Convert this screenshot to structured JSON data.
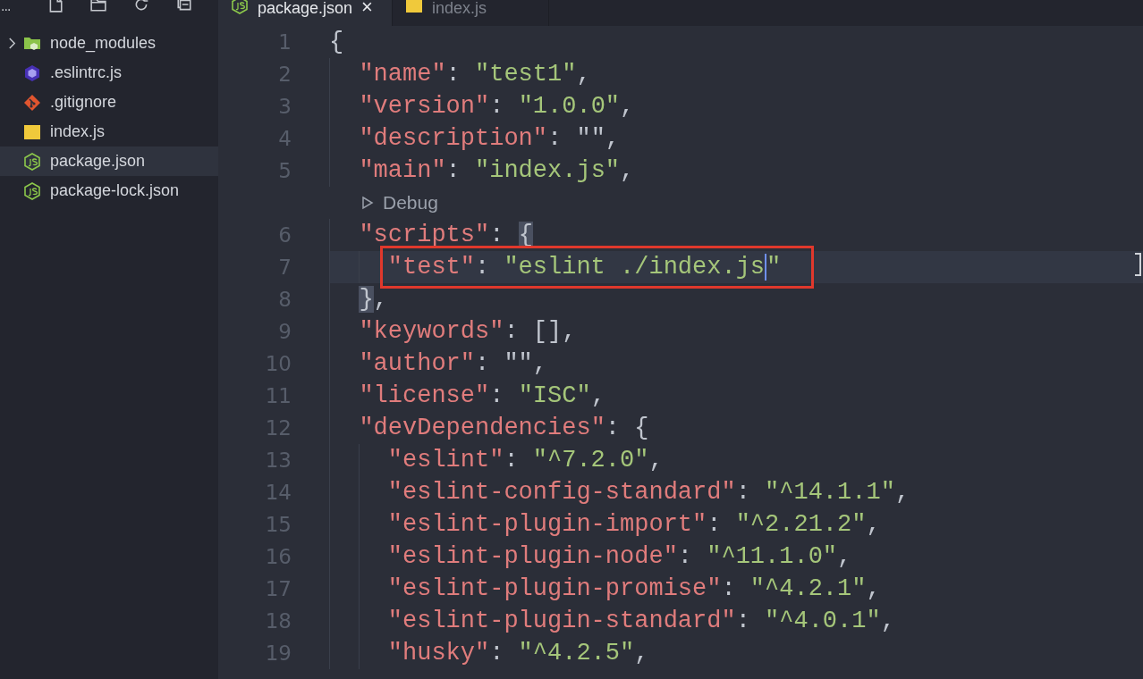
{
  "sidebar": {
    "toolbar": {
      "more": "..."
    },
    "files": [
      {
        "name": "node_modules",
        "kind": "folder",
        "expanded": false,
        "selected": false
      },
      {
        "name": ".eslintrc.js",
        "kind": "eslint",
        "selected": false
      },
      {
        "name": ".gitignore",
        "kind": "git",
        "selected": false
      },
      {
        "name": "index.js",
        "kind": "js",
        "selected": false
      },
      {
        "name": "package.json",
        "kind": "node",
        "selected": true
      },
      {
        "name": "package-lock.json",
        "kind": "node",
        "selected": false
      }
    ]
  },
  "tabs": [
    {
      "label": "package.json",
      "kind": "node",
      "selected": true,
      "close": "×"
    },
    {
      "label": "index.js",
      "kind": "js",
      "selected": false
    }
  ],
  "editor": {
    "lines": [
      {
        "kind": "code",
        "number": "1",
        "segments": [
          {
            "kind": "punct",
            "text": "{"
          }
        ],
        "children": [
          {
            "kind": "code",
            "number": "2",
            "segments": [
              {
                "kind": "key",
                "text": "\"name\""
              },
              {
                "kind": "punct",
                "text": ": "
              },
              {
                "kind": "string",
                "text": "\"test1\""
              },
              {
                "kind": "punct",
                "text": ","
              }
            ]
          },
          {
            "kind": "code",
            "number": "3",
            "segments": [
              {
                "kind": "key",
                "text": "\"version\""
              },
              {
                "kind": "punct",
                "text": ": "
              },
              {
                "kind": "string",
                "text": "\"1.0.0\""
              },
              {
                "kind": "punct",
                "text": ","
              }
            ]
          },
          {
            "kind": "code",
            "number": "4",
            "segments": [
              {
                "kind": "key",
                "text": "\"description\""
              },
              {
                "kind": "punct",
                "text": ": \"\","
              }
            ]
          },
          {
            "kind": "code",
            "number": "5",
            "segments": [
              {
                "kind": "key",
                "text": "\"main\""
              },
              {
                "kind": "punct",
                "text": ": "
              },
              {
                "kind": "string",
                "text": "\"index.js\""
              },
              {
                "kind": "punct",
                "text": ","
              }
            ]
          },
          {
            "kind": "codelens",
            "label": "Debug"
          },
          {
            "kind": "code",
            "number": "6",
            "segments": [
              {
                "kind": "key",
                "text": "\"scripts\""
              },
              {
                "kind": "punct",
                "text": ": "
              },
              {
                "kind": "bracket",
                "text": "{"
              }
            ],
            "children": [
              {
                "kind": "code",
                "number": "7",
                "current": true,
                "annotated": true,
                "segments": [
                  {
                    "kind": "key",
                    "text": "\"test\""
                  },
                  {
                    "kind": "punct",
                    "text": ": "
                  },
                  {
                    "kind": "string",
                    "text": "\"eslint ./index.js",
                    "cursor": true
                  },
                  {
                    "kind": "string",
                    "text": "\""
                  }
                ]
              }
            ]
          },
          {
            "kind": "code",
            "number": "8",
            "segments": [
              {
                "kind": "bracket",
                "text": "}"
              },
              {
                "kind": "punct",
                "text": ","
              }
            ]
          },
          {
            "kind": "code",
            "number": "9",
            "segments": [
              {
                "kind": "key",
                "text": "\"keywords\""
              },
              {
                "kind": "punct",
                "text": ": [],"
              }
            ]
          },
          {
            "kind": "code",
            "number": "10",
            "segments": [
              {
                "kind": "key",
                "text": "\"author\""
              },
              {
                "kind": "punct",
                "text": ": \"\","
              }
            ]
          },
          {
            "kind": "code",
            "number": "11",
            "segments": [
              {
                "kind": "key",
                "text": "\"license\""
              },
              {
                "kind": "punct",
                "text": ": "
              },
              {
                "kind": "string",
                "text": "\"ISC\""
              },
              {
                "kind": "punct",
                "text": ","
              }
            ]
          },
          {
            "kind": "code",
            "number": "12",
            "segments": [
              {
                "kind": "key",
                "text": "\"devDependencies\""
              },
              {
                "kind": "punct",
                "text": ": {"
              }
            ],
            "children": [
              {
                "kind": "code",
                "number": "13",
                "segments": [
                  {
                    "kind": "key",
                    "text": "\"eslint\""
                  },
                  {
                    "kind": "punct",
                    "text": ": "
                  },
                  {
                    "kind": "string",
                    "text": "\"^7.2.0\""
                  },
                  {
                    "kind": "punct",
                    "text": ","
                  }
                ]
              },
              {
                "kind": "code",
                "number": "14",
                "segments": [
                  {
                    "kind": "key",
                    "text": "\"eslint-config-standard\""
                  },
                  {
                    "kind": "punct",
                    "text": ": "
                  },
                  {
                    "kind": "string",
                    "text": "\"^14.1.1\""
                  },
                  {
                    "kind": "punct",
                    "text": ","
                  }
                ]
              },
              {
                "kind": "code",
                "number": "15",
                "segments": [
                  {
                    "kind": "key",
                    "text": "\"eslint-plugin-import\""
                  },
                  {
                    "kind": "punct",
                    "text": ": "
                  },
                  {
                    "kind": "string",
                    "text": "\"^2.21.2\""
                  },
                  {
                    "kind": "punct",
                    "text": ","
                  }
                ]
              },
              {
                "kind": "code",
                "number": "16",
                "segments": [
                  {
                    "kind": "key",
                    "text": "\"eslint-plugin-node\""
                  },
                  {
                    "kind": "punct",
                    "text": ": "
                  },
                  {
                    "kind": "string",
                    "text": "\"^11.1.0\""
                  },
                  {
                    "kind": "punct",
                    "text": ","
                  }
                ]
              },
              {
                "kind": "code",
                "number": "17",
                "segments": [
                  {
                    "kind": "key",
                    "text": "\"eslint-plugin-promise\""
                  },
                  {
                    "kind": "punct",
                    "text": ": "
                  },
                  {
                    "kind": "string",
                    "text": "\"^4.2.1\""
                  },
                  {
                    "kind": "punct",
                    "text": ","
                  }
                ]
              },
              {
                "kind": "code",
                "number": "18",
                "segments": [
                  {
                    "kind": "key",
                    "text": "\"eslint-plugin-standard\""
                  },
                  {
                    "kind": "punct",
                    "text": ": "
                  },
                  {
                    "kind": "string",
                    "text": "\"^4.0.1\""
                  },
                  {
                    "kind": "punct",
                    "text": ","
                  }
                ]
              },
              {
                "kind": "code",
                "number": "19",
                "segments": [
                  {
                    "kind": "key",
                    "text": "\"husky\""
                  },
                  {
                    "kind": "punct",
                    "text": ": "
                  },
                  {
                    "kind": "string",
                    "text": "\"^4.2.5\""
                  },
                  {
                    "kind": "punct",
                    "text": ","
                  }
                ]
              }
            ]
          }
        ]
      }
    ]
  }
}
